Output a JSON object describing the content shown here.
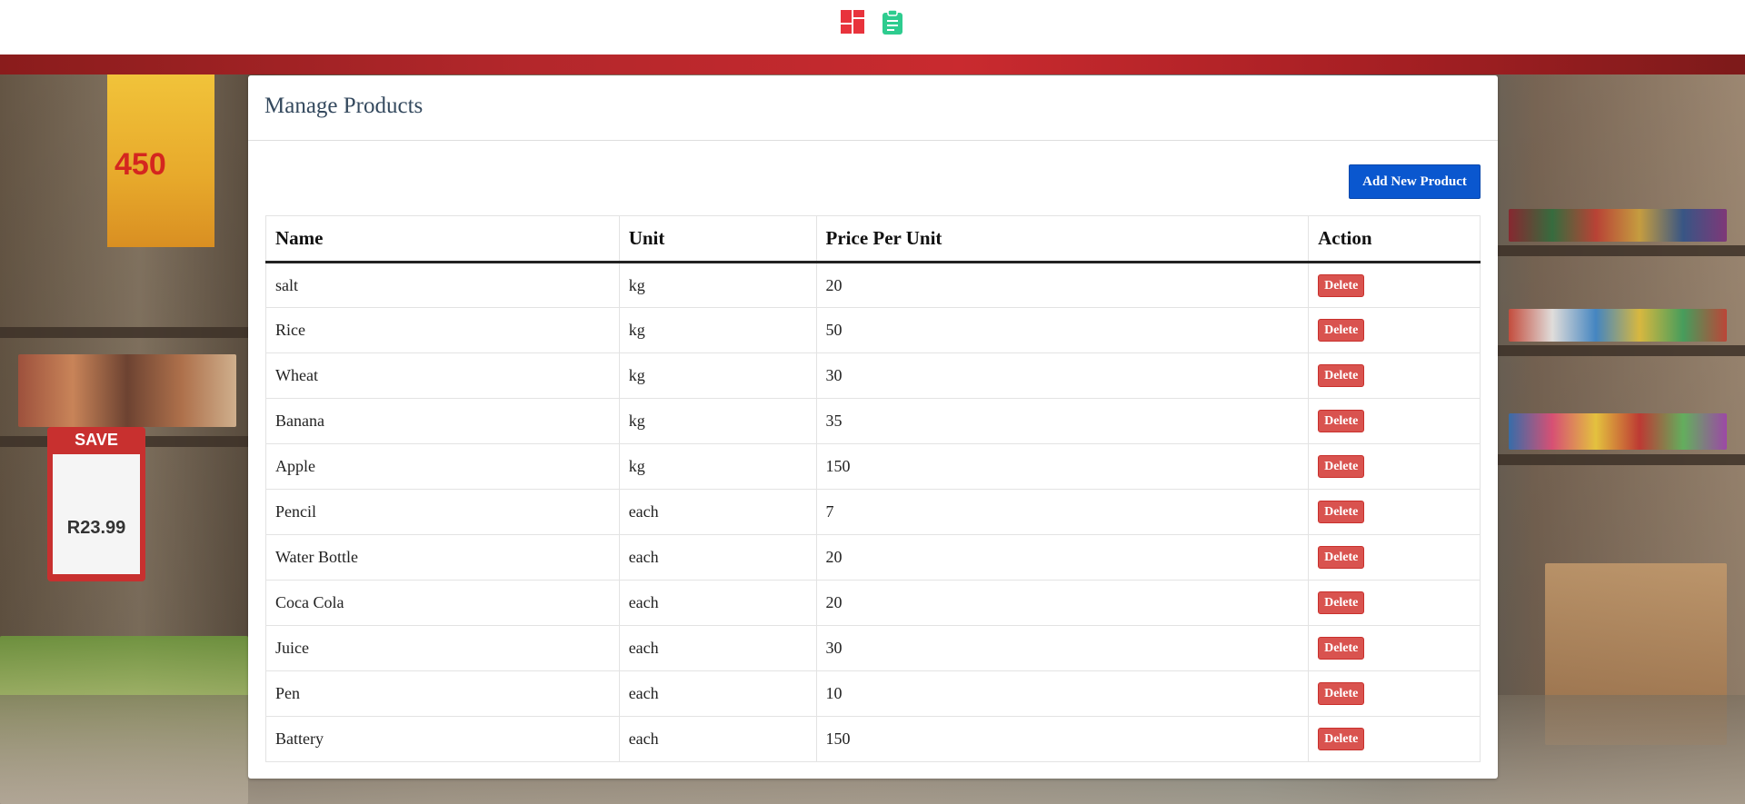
{
  "nav": {
    "dashboard_icon": "dashboard-grid-icon",
    "orders_icon": "clipboard-icon",
    "dashboard_color": "#e8333c",
    "orders_color": "#2ecc8f"
  },
  "background": {
    "sign_head": "SAVE",
    "sign_price": "R23.99",
    "cheese_count": "450"
  },
  "page": {
    "title": "Manage Products",
    "add_button": "Add New Product"
  },
  "table": {
    "headers": {
      "name": "Name",
      "unit": "Unit",
      "price": "Price Per Unit",
      "action": "Action"
    },
    "delete_label": "Delete",
    "rows": [
      {
        "name": "salt",
        "unit": "kg",
        "price": "20"
      },
      {
        "name": "Rice",
        "unit": "kg",
        "price": "50"
      },
      {
        "name": "Wheat",
        "unit": "kg",
        "price": "30"
      },
      {
        "name": "Banana",
        "unit": "kg",
        "price": "35"
      },
      {
        "name": "Apple",
        "unit": "kg",
        "price": "150"
      },
      {
        "name": "Pencil",
        "unit": "each",
        "price": "7"
      },
      {
        "name": "Water Bottle",
        "unit": "each",
        "price": "20"
      },
      {
        "name": "Coca Cola",
        "unit": "each",
        "price": "20"
      },
      {
        "name": "Juice",
        "unit": "each",
        "price": "30"
      },
      {
        "name": "Pen",
        "unit": "each",
        "price": "10"
      },
      {
        "name": "Battery",
        "unit": "each",
        "price": "150"
      }
    ]
  },
  "colors": {
    "primary_button": "#0a57cf",
    "danger_button": "#d9534f",
    "title_text": "#34495e"
  }
}
